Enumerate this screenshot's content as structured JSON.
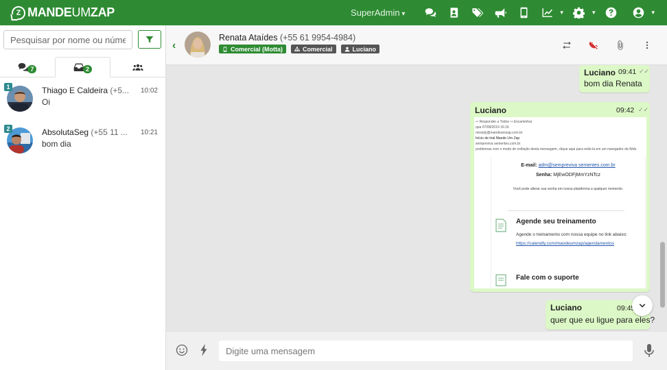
{
  "app": {
    "logo_prefix": "MANDE",
    "logo_middle": "UM",
    "logo_suffix": "ZAP",
    "logo_mark": "Z",
    "user_menu": "SuperAdmin",
    "brand_color": "#2e8b33",
    "nav_icons": [
      "comments-icon",
      "contacts-icon",
      "tags-icon",
      "megaphone-icon",
      "mobile-icon",
      "chart-icon",
      "gear-icon",
      "help-icon",
      "user-icon"
    ]
  },
  "sidebar": {
    "search_placeholder": "Pesquisar por nome ou número...",
    "tabs": [
      {
        "icon": "chats-icon",
        "badge": "7"
      },
      {
        "icon": "inbox-icon",
        "badge": "2"
      },
      {
        "icon": "users-icon",
        "badge": ""
      }
    ],
    "conversations": [
      {
        "index": "1",
        "name": "Thiago E Caldeira",
        "phone": "(+5...",
        "time": "10:02",
        "preview": "Oi"
      },
      {
        "index": "2",
        "name": "AbsolutaSeg",
        "phone": "(+55 11 ...",
        "time": "10:21",
        "preview": "bom dia"
      }
    ]
  },
  "chat": {
    "contact_name": "Renata Ataídes",
    "contact_phone": "(+55 61 9954-4984)",
    "tags": [
      {
        "label": "Comercial (Motta)",
        "icon": "mobile-icon",
        "color": "#2e8b33"
      },
      {
        "label": "Comercial",
        "icon": "sitemap-icon",
        "color": "#555555"
      },
      {
        "label": "Luciano",
        "icon": "user-icon",
        "color": "#555555"
      }
    ],
    "messages": [
      {
        "author": "Luciano",
        "time": "09:41",
        "text": "bom dia Renata"
      },
      {
        "author": "Luciano",
        "time": "09:42",
        "text": ""
      },
      {
        "author": "Luciano",
        "time": "09:45",
        "text": "quer que eu ligue para eles?"
      }
    ],
    "email_preview": {
      "toolbar": "↩ Responder a Todos  ↪ Encaminhar",
      "date": "qua 07/08/2019 16:16",
      "from": "noreply@mandeumzap.com.br",
      "subject": "Início de trial Mande Um Zap",
      "to": "sempreviva sementes.com.br",
      "notice": "problemas com o modo de exibição desta mensagem, clique aqui para exibi-la em um navegador da Web.",
      "email_label": "E-mail:",
      "email_value": "adm@sempreviva sementes.com.br",
      "password_label": "Senha:",
      "password_value": "MjEwODFjMmYzNTcz",
      "change_note": "Você pode alterar sua senha em nossa plataforma a qualquer momento.",
      "training_title": "Agende seu treinamento",
      "training_text": "Agende o treinamento com nossa equipe no link abaixo:",
      "training_link": "https://calendly.com/mandeumzap/agendamentos",
      "support_title": "Fale com o suporte"
    },
    "composer_placeholder": "Digite uma mensagem"
  }
}
